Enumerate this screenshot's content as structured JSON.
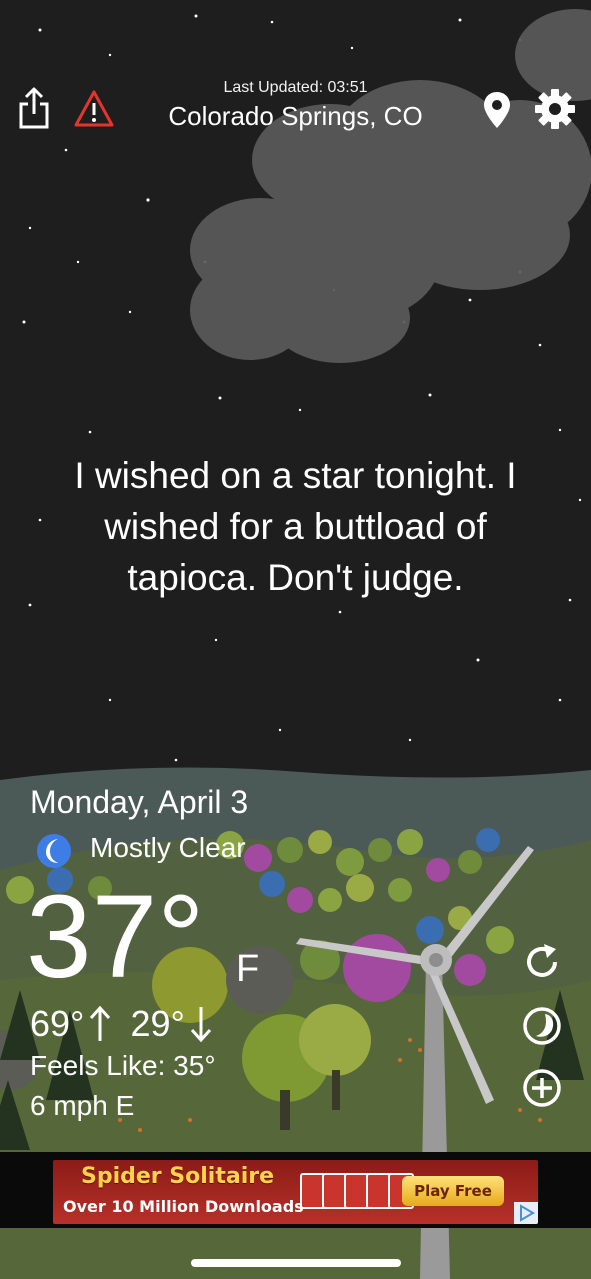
{
  "header": {
    "last_updated": "Last Updated: 03:51",
    "location": "Colorado Springs, CO",
    "icons": [
      "share-icon",
      "alert-icon",
      "location-pin-icon",
      "gear-icon"
    ]
  },
  "quote": {
    "line1": "I wished on a star tonight. I",
    "line2": "wished for a buttload of",
    "line3": "tapioca. Don't judge."
  },
  "weather": {
    "date": "Monday, April 3",
    "condition": "Mostly Clear",
    "condition_icon": "moon-icon",
    "temperature": "37°",
    "unit": "F",
    "high": "69°",
    "low": "29°",
    "feels_like": "Feels Like: 35°",
    "wind": "6 mph E"
  },
  "side_buttons": [
    "refresh-icon",
    "radar-icon",
    "add-icon"
  ],
  "ad": {
    "title": "Spider Solitaire",
    "subtitle": "Over 10 Million Downloads",
    "cta": "Play Free"
  },
  "colors": {
    "sky": "#1e1e1f",
    "hill_far": "#4c5a57",
    "hill_near": "#55663f",
    "moon": "#3f7de6",
    "alert": "#e3352b",
    "ad_red": "#b7312a",
    "ad_yellow": "#ffd34a"
  }
}
